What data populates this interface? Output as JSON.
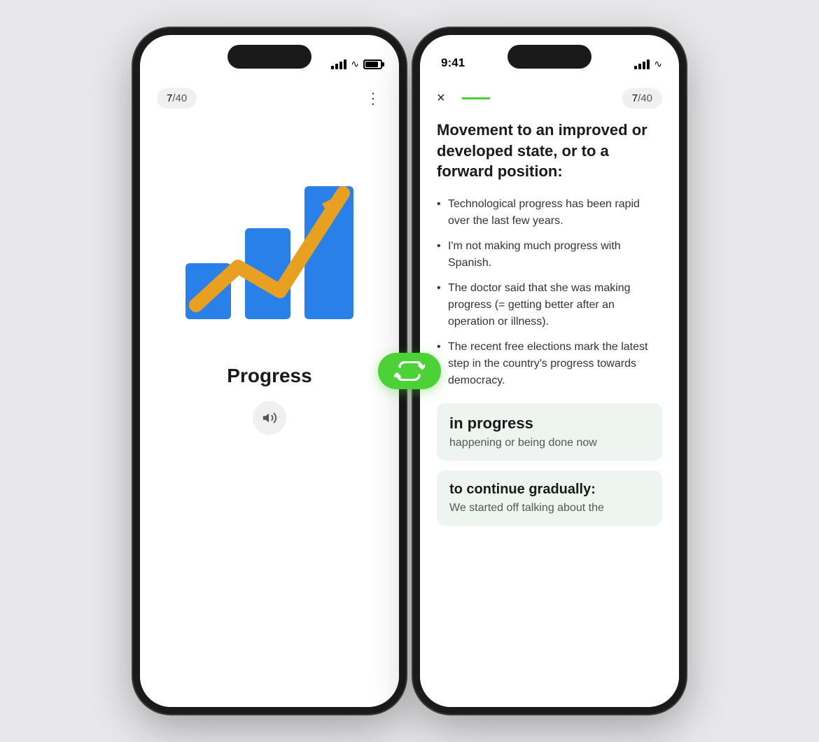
{
  "left_phone": {
    "time": "",
    "progress": {
      "current": "7",
      "total": "40",
      "label": "7/40"
    },
    "menu_icon": "···",
    "word": "Progress",
    "audio_label": "🔊"
  },
  "flip_button": {
    "label": "↻"
  },
  "right_phone": {
    "time": "9:41",
    "progress": {
      "current": "7",
      "total": "40",
      "label": "7/40"
    },
    "close_label": "×",
    "main_definition": "Movement to an improved or developed state, or to a forward position:",
    "examples": [
      "Technological progress has been rapid over the last few years.",
      "I'm not making much progress with Spanish.",
      "The doctor said that she was making progress (= getting better after an operation or illness).",
      "The recent free elections mark the latest step in the country's progress towards democracy."
    ],
    "phrase1": {
      "title": "in progress",
      "desc": "happening or being done now"
    },
    "phrase2": {
      "title": "to continue gradually:",
      "desc": "We started off talking about the"
    }
  },
  "colors": {
    "green": "#4cd137",
    "blue": "#2980e8",
    "orange": "#e8a020",
    "light_green_bg": "#eef5f0",
    "badge_bg": "#f0f0f0"
  }
}
